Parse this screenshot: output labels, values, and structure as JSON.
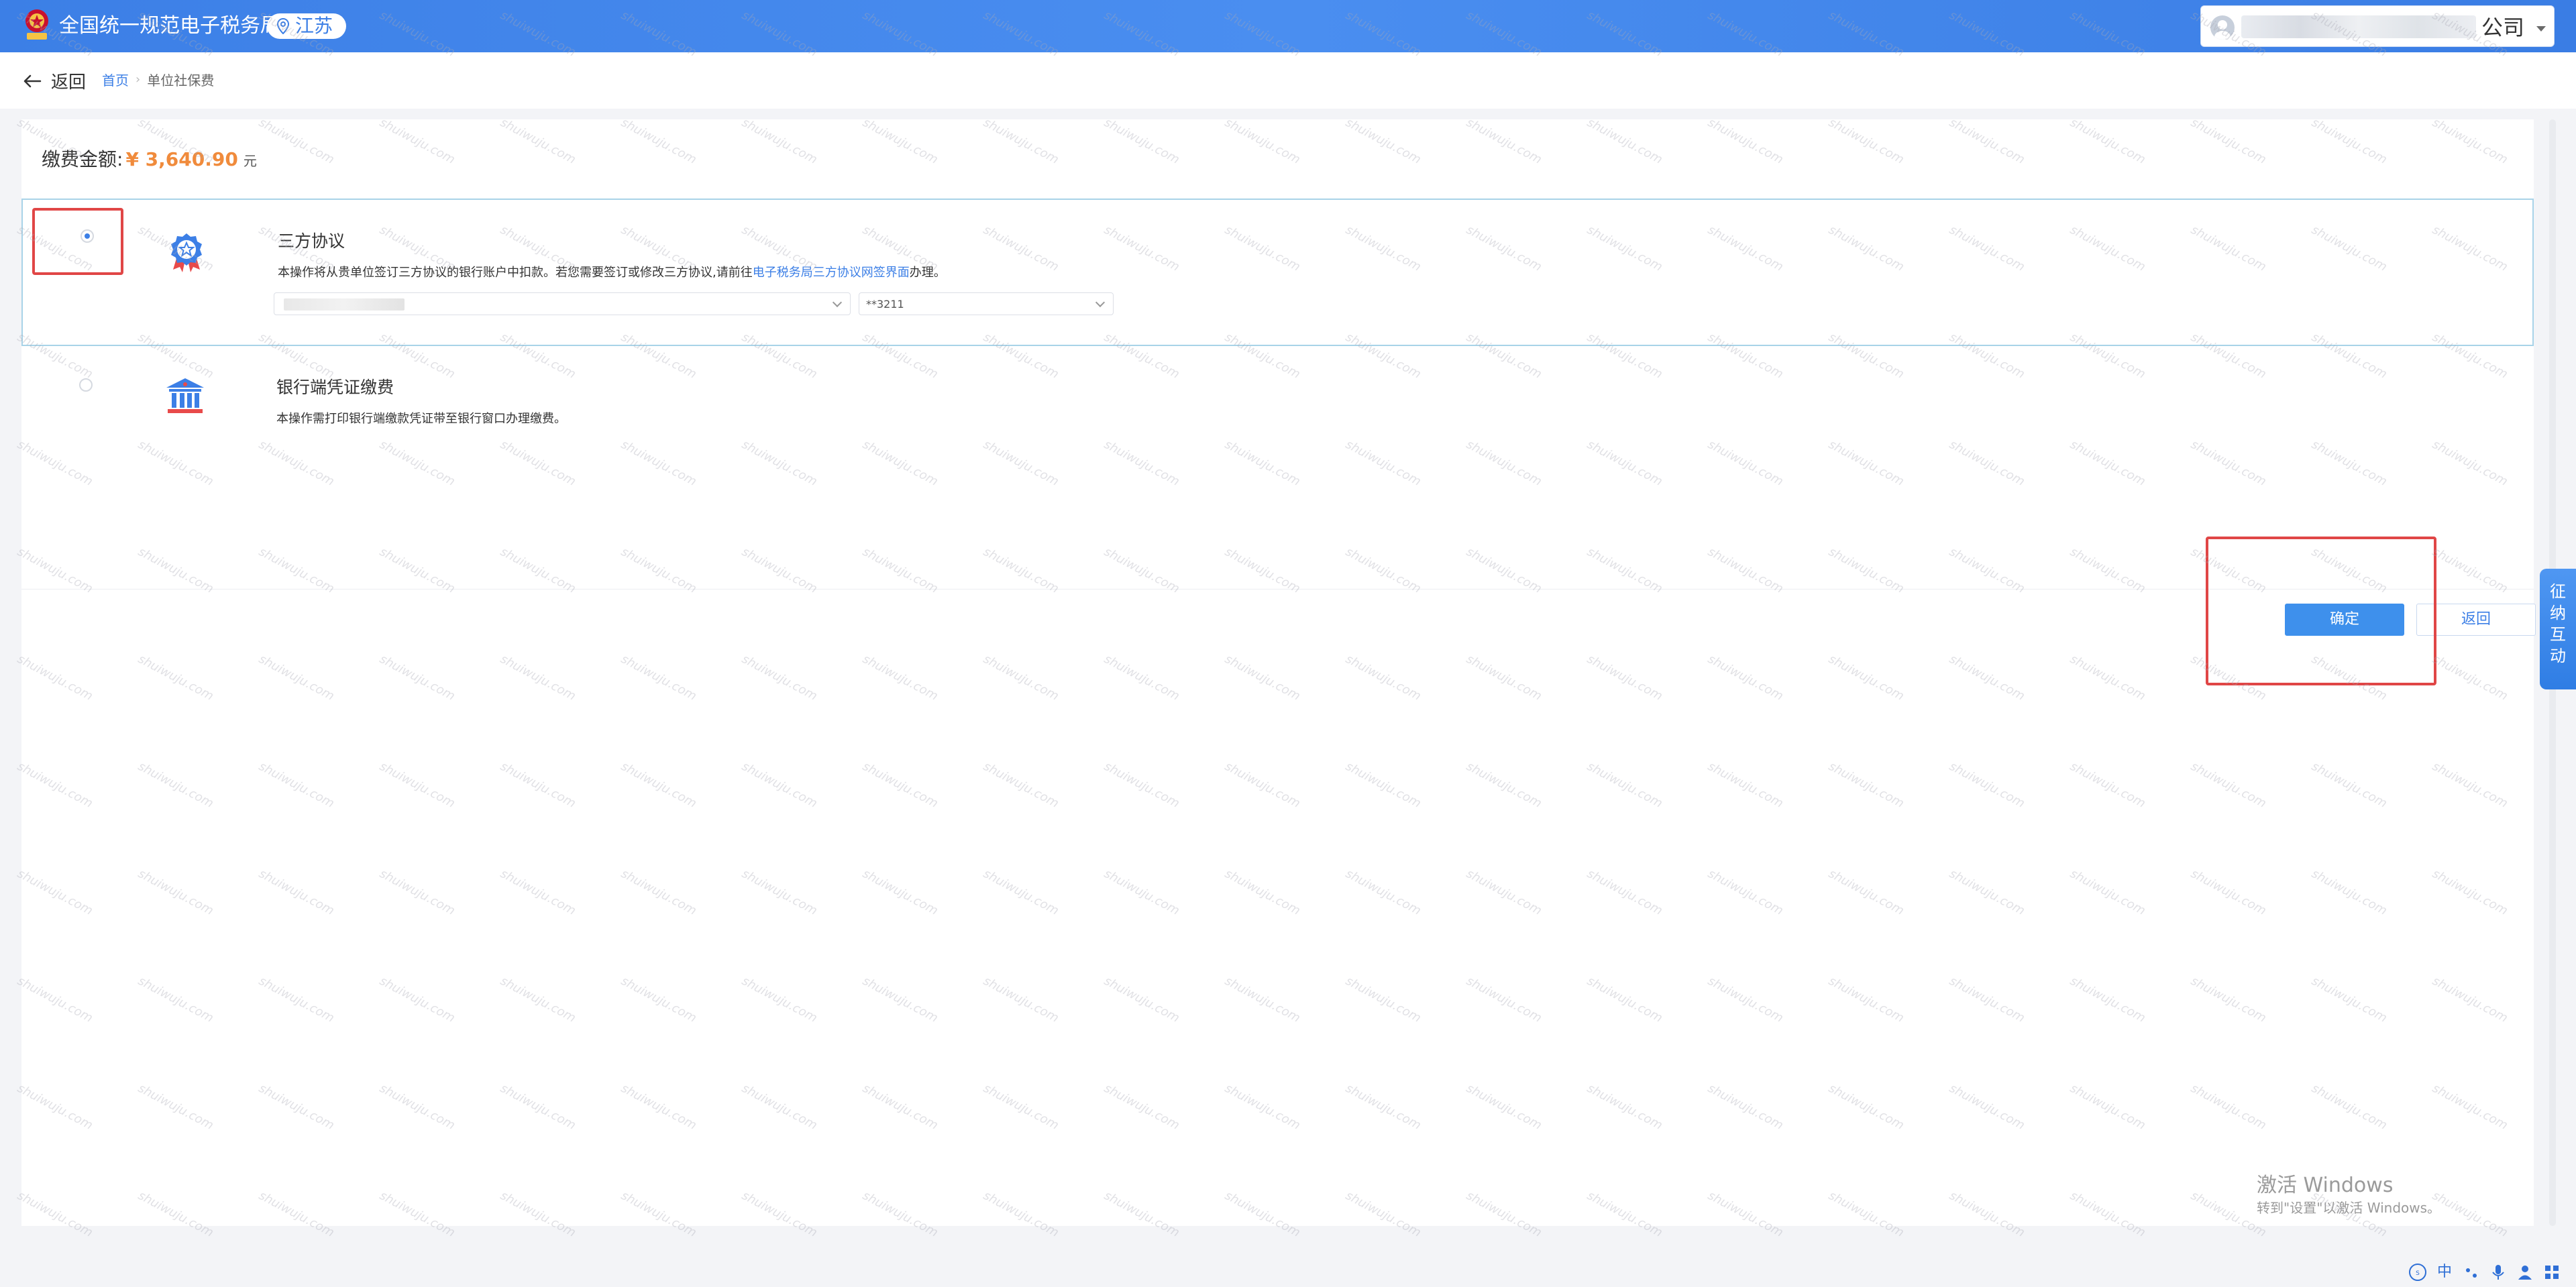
{
  "header": {
    "site_title": "全国统一规范电子税务局",
    "region": "江苏",
    "user_name_suffix": "公司"
  },
  "breadcrumb": {
    "back_label": "返回",
    "home": "首页",
    "current": "单位社保费"
  },
  "payment": {
    "amount_label": "缴费金额:",
    "amount_value": "¥ 3,640.90",
    "amount_unit": "元"
  },
  "options": [
    {
      "title": "三方协议",
      "desc_prefix": "本操作将从贵单位签订三方协议的银行账户中扣款。若您需要签订或修改三方协议,请前往",
      "desc_link": "电子税务局三方协议网签界面",
      "desc_suffix": "办理。",
      "selected": true,
      "account_select_value": "",
      "card_select_value": "**3211"
    },
    {
      "title": "银行端凭证缴费",
      "desc": "本操作需打印银行端缴款凭证带至银行窗口办理缴费。",
      "selected": false
    }
  ],
  "buttons": {
    "confirm": "确定",
    "back": "返回"
  },
  "float_tab": {
    "label_lines": [
      "征",
      "纳",
      "互",
      "动"
    ]
  },
  "windows_activation": {
    "title": "激活 Windows",
    "subtitle": "转到\"设置\"以激活 Windows。"
  },
  "tray": {
    "ime": "中"
  },
  "watermark_text": "shuiwuju.com",
  "colors": {
    "header_blue": "#3c7fe6",
    "amount_orange": "#f08b3c",
    "highlight_red": "#e04646",
    "selected_border": "#a8d3e8"
  }
}
